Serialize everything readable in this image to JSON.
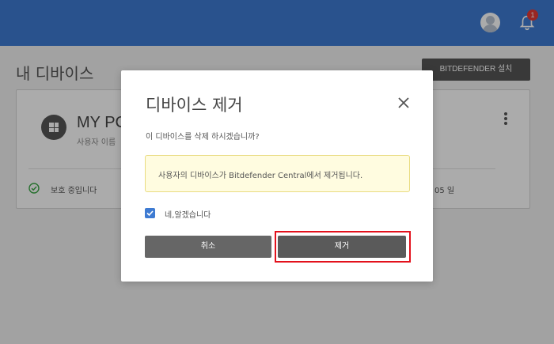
{
  "header": {
    "notification_count": "1",
    "icons": {
      "avatar": "user-avatar-icon",
      "bell": "bell-icon"
    },
    "colors": {
      "bar": "#3e7bd2",
      "badge": "#e53935"
    }
  },
  "page": {
    "title": "내 디바이스",
    "install_button": "BITDEFENDER 설치"
  },
  "device": {
    "name": "MY PC",
    "subtitle": "사용자 이름",
    "status": "보호 중입니다",
    "date_suffix": "05 일"
  },
  "dialog": {
    "title": "디바이스 제거",
    "question": "이 디바이스를 삭제 하시겠습니까?",
    "notice": "사용자의 디바이스가 Bitdefender Central에서 제거됩니다.",
    "checkbox_label": "네,알겠습니다",
    "checkbox_checked": true,
    "cancel_label": "취소",
    "remove_label": "제거",
    "colors": {
      "checkbox": "#3e7bd2",
      "highlight": "#e3111c",
      "notice_bg": "#fffce0"
    }
  }
}
